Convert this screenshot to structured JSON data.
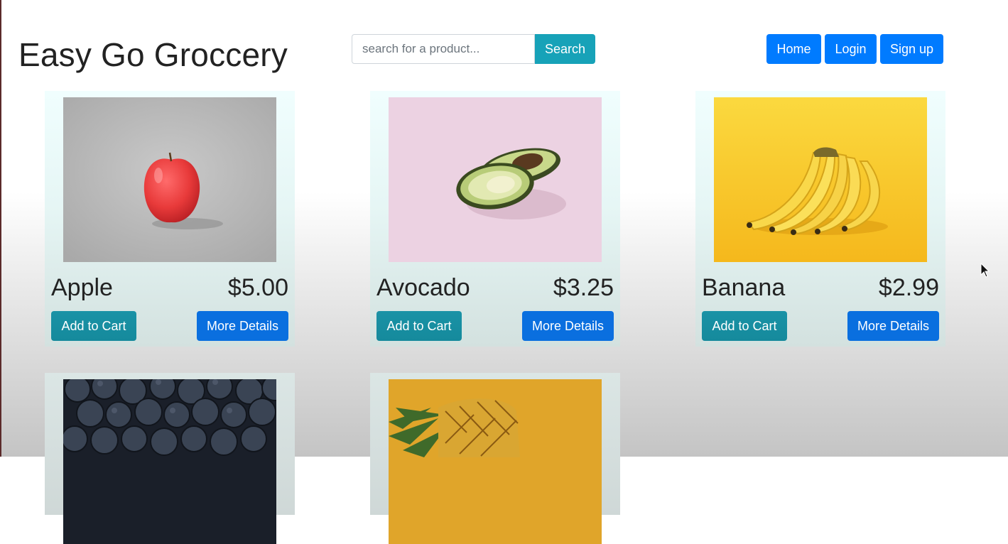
{
  "header": {
    "title": "Easy Go Groccery",
    "search_placeholder": "search for a product...",
    "search_button": "Search",
    "nav": [
      "Home",
      "Login",
      "Sign up"
    ]
  },
  "products": [
    {
      "name": "Apple",
      "price": "$5.00",
      "add_label": "Add to Cart",
      "details_label": "More Details",
      "image": "apple-photo"
    },
    {
      "name": "Avocado",
      "price": "$3.25",
      "add_label": "Add to Cart",
      "details_label": "More Details",
      "image": "avocado-photo"
    },
    {
      "name": "Banana",
      "price": "$2.99",
      "add_label": "Add to Cart",
      "details_label": "More Details",
      "image": "banana-photo"
    },
    {
      "image": "blueberries-photo"
    },
    {
      "image": "pineapple-photo"
    }
  ],
  "colors": {
    "primary": "#007bff",
    "info": "#17a2b8",
    "details": "#0a6fdf"
  }
}
